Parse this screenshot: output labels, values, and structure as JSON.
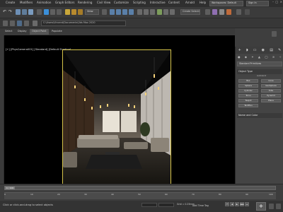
{
  "menu": {
    "items": [
      "Create",
      "Modifiers",
      "Animation",
      "Graph Editors",
      "Rendering",
      "Civil View",
      "Customize",
      "Scripting",
      "Interactive",
      "Content",
      "Arnold",
      "Help"
    ],
    "workspace": "Workspaces: Default",
    "sign_in": "Sign In"
  },
  "toolbar": {
    "view_dropdown": "View",
    "selection_set": "Create Selection Se"
  },
  "ribbon": {
    "file_path": "C:\\Users\\Vincent\\Documents\\3ds Max 2020"
  },
  "tabs": [
    "Select",
    "Display",
    "Object Paint",
    "Populate"
  ],
  "viewport": {
    "label": "[+] [PhysCamera001] [Standard] [Default Shading]"
  },
  "command_panel": {
    "tab_icons": [
      "+",
      "◗",
      "▭",
      "◉",
      "▤",
      "✎"
    ],
    "subtype_icons": [
      "●",
      "◆",
      "✦",
      "▲",
      "◯",
      "≋",
      "✧"
    ],
    "category": "Standard Primitives",
    "object_type_header": "Object Type",
    "autogrid": "AutoGrid",
    "object_buttons": [
      "Box",
      "Cone",
      "Sphere",
      "GeoSphere",
      "Cylinder",
      "Tube",
      "Torus",
      "Pyramid",
      "Teapot",
      "Plane",
      "TextPlus"
    ],
    "name_color_header": "Name and Color"
  },
  "timeline": {
    "thumb": "0 / 100",
    "ticks": [
      "0",
      "10",
      "20",
      "30",
      "40",
      "50",
      "60",
      "70",
      "80",
      "90",
      "100"
    ]
  },
  "status": {
    "message": "Click or click-and-drag to select objects",
    "grid": "Grid = 0.25mm",
    "add_time_tag": "Add Time Tag"
  },
  "playback": {
    "buttons": [
      "⏮",
      "◀",
      "▶",
      "▶▶",
      "⏭"
    ],
    "auto_key": "+"
  },
  "colors": {
    "viewport_border": "#d6c44a",
    "panel_bg": "#444444",
    "menu_bg": "#2f2f2f"
  }
}
